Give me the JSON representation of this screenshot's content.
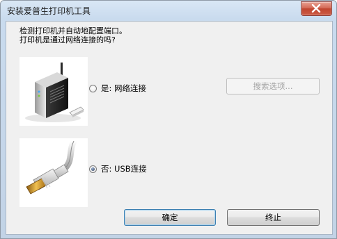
{
  "window": {
    "title": "安装爱普生打印机工具"
  },
  "prompt": {
    "line1": "检测打印机并自动地配置端口。",
    "line2": "打印机是通过网络连接的吗?"
  },
  "options": {
    "network_label": "是: 网络连接",
    "network_selected": false,
    "usb_label": "否: USB连接",
    "usb_selected": true
  },
  "buttons": {
    "search_label": "搜索选项...",
    "search_enabled": false,
    "ok_label": "确定",
    "stop_label": "终止"
  },
  "icons": {
    "router": "network-printer-router-icon",
    "usb": "usb-cable-icon",
    "close": "close-icon"
  },
  "colors": {
    "close_button": "#c94a35",
    "dialog_background": "#f0f0f0",
    "titlebar": "#c9dbee",
    "default_button_border": "#3c7fb1"
  }
}
